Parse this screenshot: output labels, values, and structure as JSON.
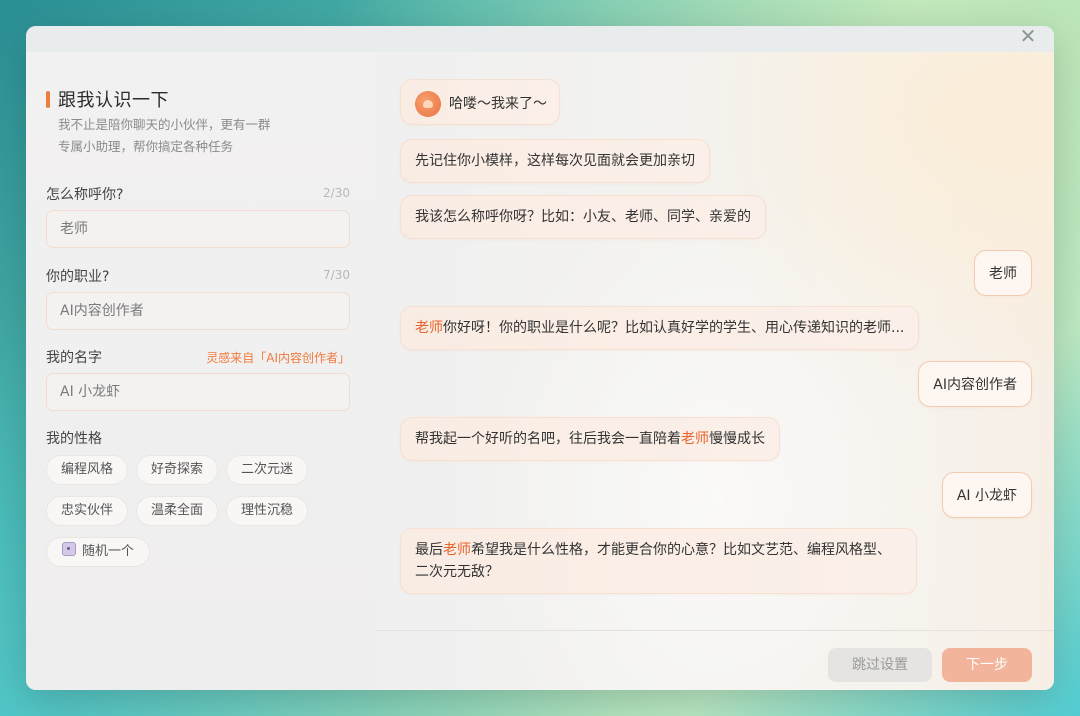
{
  "dialog": {
    "close_icon": "close-icon"
  },
  "intro": {
    "title": "跟我认识一下",
    "subtitle_line1": "我不止是陪你聊天的小伙伴，更有一群",
    "subtitle_line2": "专属小助理，帮你搞定各种任务"
  },
  "fields": {
    "nickname": {
      "label": "怎么称呼你?",
      "count": "2/30",
      "value": "老师"
    },
    "job": {
      "label": "你的职业?",
      "count": "7/30",
      "value": "AI内容创作者"
    },
    "name": {
      "label": "我的名字",
      "hint": "灵感来自「AI内容创作者」",
      "value": "AI 小龙虾"
    }
  },
  "personality": {
    "label": "我的性格",
    "chips": [
      "编程风格",
      "好奇探索",
      "二次元迷",
      "忠实伙伴",
      "温柔全面",
      "理性沉稳"
    ],
    "random_label": "随机一个",
    "random_icon": "dice-icon"
  },
  "chat": {
    "m1": "哈喽～我来了～",
    "m2": "先记住你小模样，这样每次见面就会更加亲切",
    "m3": "我该怎么称呼你呀？比如：小友、老师、同学、亲爱的",
    "u1": "老师",
    "m4_hl": "老师",
    "m4_rest": "你好呀！你的职业是什么呢？比如认真好学的学生、用心传递知识的老师...",
    "u2": "AI内容创作者",
    "m5_pre": "帮我起一个好听的名吧，往后我会一直陪着",
    "m5_hl": "老师",
    "m5_post": "慢慢成长",
    "u3": "AI 小龙虾",
    "m6_pre": "最后",
    "m6_hl": "老师",
    "m6_post_line1": "希望我是什么性格，才能更合你的心意？比如文艺范、编程风格型、",
    "m6_line2": "二次元无敌？"
  },
  "footer": {
    "skip_label": "跳过设置",
    "next_label": "下一步"
  },
  "colors": {
    "accent": "#f07a3e",
    "highlight": "#e8642c",
    "next_button": "#f2b49a"
  }
}
